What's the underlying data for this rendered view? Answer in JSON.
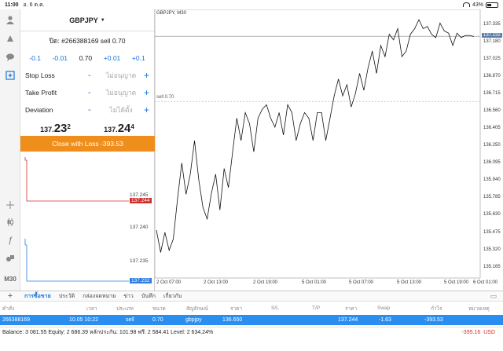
{
  "status": {
    "time": "11:00",
    "date": "อ. 6 ต.ค.",
    "battery": "43%"
  },
  "sidebar": {
    "timeframe": "M30"
  },
  "panel": {
    "symbol": "GBPJPY",
    "order_line": "ปิด: #266388169 sell 0.70",
    "volume": [
      "-0.1",
      "-0.01",
      "0.70",
      "+0.01",
      "+0.1"
    ],
    "fields": [
      {
        "label": "Stop Loss",
        "value": "ไม่อนุญาต"
      },
      {
        "label": "Take Profit",
        "value": "ไม่อนุญาต"
      },
      {
        "label": "Deviation",
        "value": "ไม่ได้ตั้ง"
      }
    ],
    "bid": {
      "prefix": "137.",
      "big": "23",
      "sup": "2"
    },
    "ask": {
      "prefix": "137.",
      "big": "24",
      "sup": "4"
    },
    "close_button": "Close with Loss -393.53",
    "tick_labels": [
      "137.245",
      "137.244",
      "137.240",
      "137.235",
      "137.232"
    ],
    "colors": {
      "bid": "#d0302b",
      "ask": "#2a7de1",
      "button": "#f08e1c"
    }
  },
  "chart": {
    "title": "GBPJPY, M30",
    "sell_label": "sell 0.70",
    "y_ticks": [
      "137.335",
      "137.180",
      "137.025",
      "136.870",
      "136.715",
      "136.560",
      "136.405",
      "136.250",
      "136.095",
      "135.940",
      "135.785",
      "135.630",
      "135.475",
      "135.320",
      "135.165"
    ],
    "price_tag": "137.232",
    "x_ticks": [
      "2 Oct 07:00",
      "2 Oct 13:00",
      "2 Oct 19:00",
      "5 Oct 01:00",
      "5 Oct 07:00",
      "5 Oct 13:00",
      "5 Oct 19:00",
      "6 Oct 01:00"
    ]
  },
  "chart_data": {
    "type": "line",
    "title": "GBPJPY, M30",
    "ylim": [
      135.1,
      137.43
    ],
    "y_ticks": [
      137.335,
      137.18,
      137.025,
      136.87,
      136.715,
      136.56,
      136.405,
      136.25,
      136.095,
      135.94,
      135.785,
      135.63,
      135.475,
      135.32,
      135.165
    ],
    "x_ticks": [
      "2 Oct 07:00",
      "2 Oct 13:00",
      "2 Oct 19:00",
      "5 Oct 01:00",
      "5 Oct 07:00",
      "5 Oct 13:00",
      "5 Oct 19:00",
      "6 Oct 01:00"
    ],
    "series": [
      {
        "values": [
          135.5,
          135.3,
          135.48,
          135.32,
          135.42,
          135.78,
          136.1,
          135.82,
          136.0,
          136.3,
          135.95,
          135.7,
          135.6,
          135.83,
          136.0,
          135.68,
          136.05,
          135.88,
          136.2,
          136.5,
          136.3,
          136.55,
          136.45,
          136.2,
          136.5,
          136.58,
          136.62,
          136.5,
          136.42,
          136.55,
          136.35,
          136.62,
          136.55,
          136.3,
          136.45,
          136.55,
          136.5,
          136.3,
          136.55,
          136.55,
          136.3,
          136.5,
          136.7,
          136.85,
          136.7,
          136.8,
          136.6,
          136.72,
          136.9,
          136.75,
          136.95,
          137.1,
          136.9,
          137.15,
          137.05,
          137.25,
          137.2,
          137.3,
          137.05,
          137.1,
          137.25,
          137.3,
          137.38,
          137.3,
          137.32,
          137.25,
          137.22,
          137.35,
          137.28,
          137.26,
          137.15,
          137.26,
          137.22,
          137.24,
          137.24,
          137.23
        ]
      }
    ],
    "horizontal_lines": [
      {
        "label": "sell 0.70",
        "value": 136.65
      },
      {
        "value": 137.232
      }
    ]
  },
  "tabs": {
    "items": [
      "การซื้อขาย",
      "ประวัติ",
      "กล่องจดหมาย",
      "ข่าว",
      "บันทึก",
      "เกี่ยวกับ"
    ],
    "active": 0
  },
  "table": {
    "headers": [
      "คำสั่ง",
      "เวลา",
      "ประเภท",
      "ขนาด",
      "สัญลักษณ์",
      "ราคา",
      "S/L",
      "T/P",
      "ราคา",
      "Swap",
      "กำไร",
      "หมายเหตุ"
    ],
    "row": [
      "266388169",
      "10.05 10:22",
      "sell",
      "0.70",
      "gbpjpy",
      "136.650",
      "",
      "",
      "137.244",
      "-1.63",
      "-393.53",
      ""
    ]
  },
  "balance": {
    "text": "Balance: 3 081.55 Equity: 2 686.39 หลักประกัน: 101.98 ฟรี: 2 584.41 Level: 2 634.24%",
    "value": "-395.16",
    "currency": "USD"
  }
}
